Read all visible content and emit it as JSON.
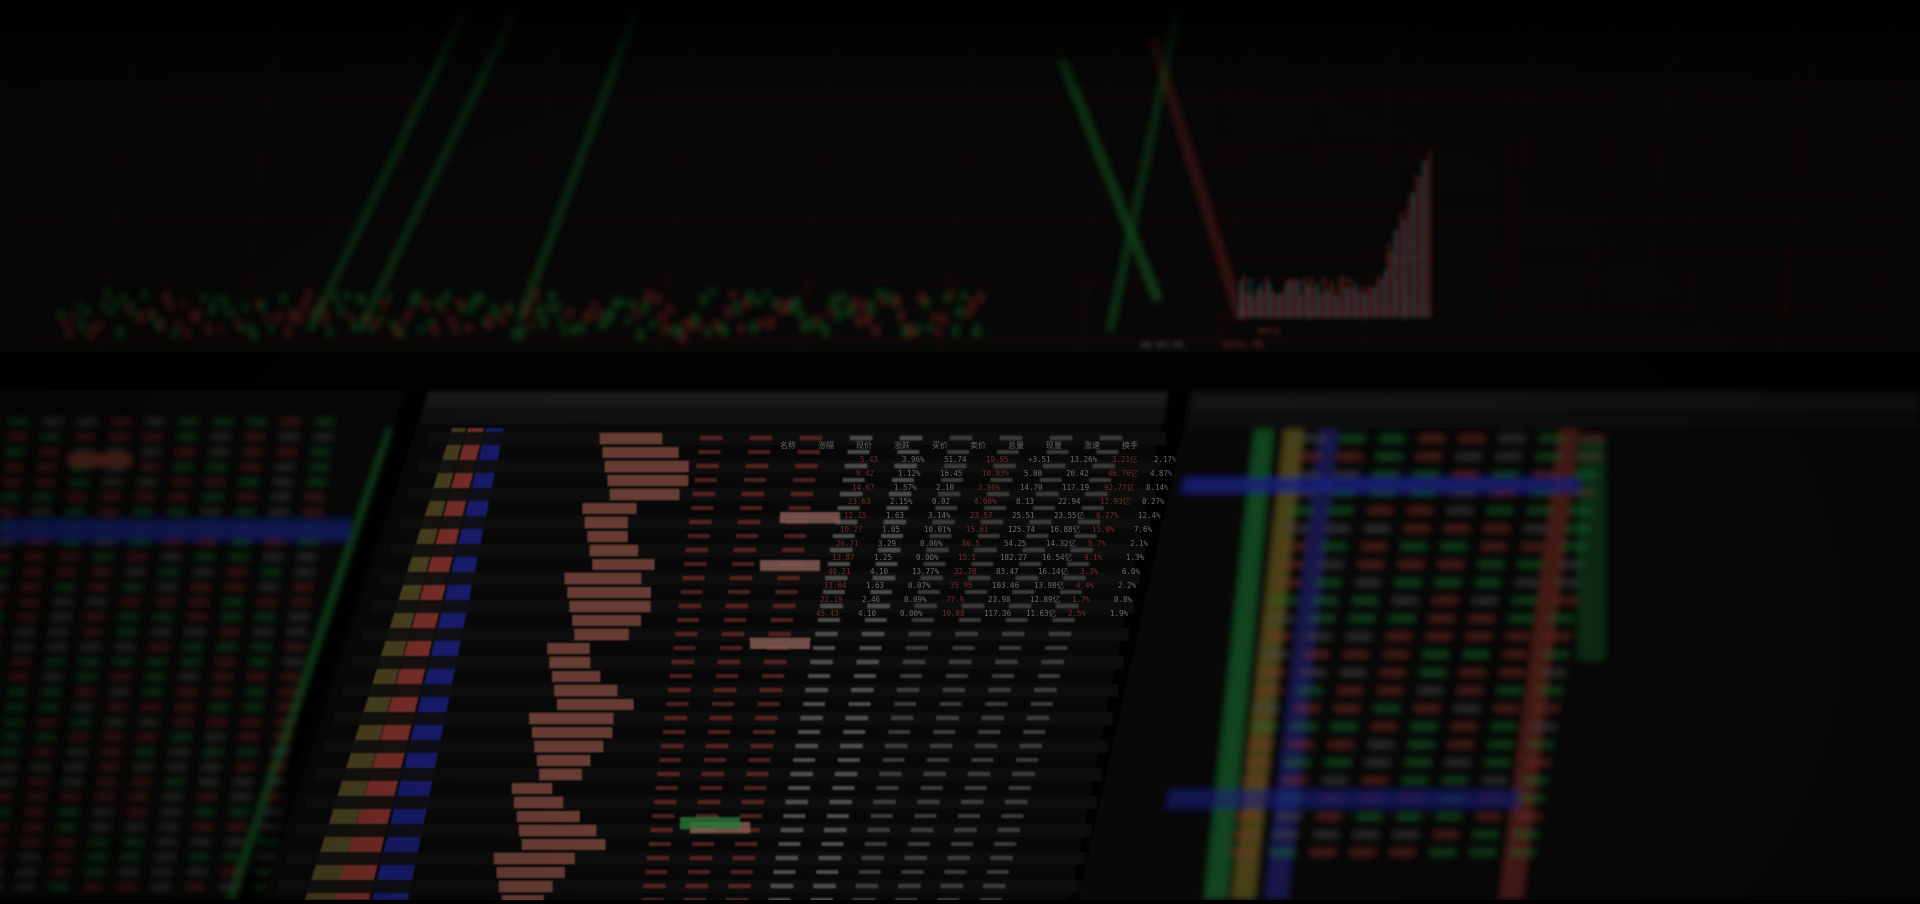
{
  "scene": {
    "description_labels": {
      "upper_right_readout": "3231.45",
      "upper_center_time": "16:43:43",
      "upper_right_indicator": "MACD"
    }
  },
  "colors": {
    "up": "#e0534a",
    "down": "#2fbf4f",
    "accent_blue": "#2d3bd6",
    "grid": "#5a1414",
    "panel_bg": "#0c0c0c",
    "text_dim": "#9a9a9a",
    "highlight_row": "#d87b6a"
  },
  "left_table": {
    "rows": 32
  },
  "center_table": {
    "header": [
      "名称",
      "涨幅",
      "现价",
      "涨跌",
      "买价",
      "卖价",
      "总量",
      "现量",
      "涨速",
      "换手"
    ],
    "rows": [
      [
        "5.43",
        "3.96%",
        "51.74",
        "19.95",
        "+3.51",
        "13.26%",
        "3.21亿",
        "2.17%"
      ],
      [
        "9.42",
        "1.12%",
        "16.45",
        "10.03%",
        "5.08",
        "20.42",
        "46.76亿",
        "4.87%"
      ],
      [
        "14.67",
        "1.57%",
        "2.10",
        "3.90%",
        "14.70",
        "117.19",
        "92.77亿",
        "8.14%"
      ],
      [
        "23.63",
        "2.15%",
        "0.02",
        "4.00%",
        "8.13",
        "22.94",
        "12.93亿",
        "0.27%"
      ],
      [
        "12.15",
        "1.63",
        "3.14%",
        "23.57",
        "25.51",
        "23.55亿",
        "0.77%",
        "12.4%"
      ],
      [
        "10.27",
        "1.05",
        "10.01%",
        "15.61",
        "125.74",
        "16.88亿",
        "11.8%",
        "7.6%"
      ],
      [
        "26.71",
        "3.29",
        "0.06%",
        "86.5",
        "54.25",
        "14.32亿",
        "5.7%",
        "2.1%"
      ],
      [
        "13.87",
        "1.25",
        "0.00%",
        "15.1",
        "182.27",
        "16.54亿",
        "9.1%",
        "1.3%"
      ],
      [
        "40.21",
        "4.10",
        "13.77%",
        "32.78",
        "83.47",
        "16.14亿",
        "3.3%",
        "6.0%"
      ],
      [
        "11.04",
        "1.63",
        "0.07%",
        "35.95",
        "103.46",
        "13.98亿",
        "4.4%",
        "2.2%"
      ],
      [
        "22.19",
        "2.46",
        "0.09%",
        "77.9",
        "23.98",
        "12.89亿",
        "1.7%",
        "0.8%"
      ],
      [
        "45.43",
        "4.10",
        "0.00%",
        "10.08",
        "117.36",
        "11.63亿",
        "2.5%",
        "1.9%"
      ]
    ]
  },
  "right_table": {
    "rows": 24
  }
}
